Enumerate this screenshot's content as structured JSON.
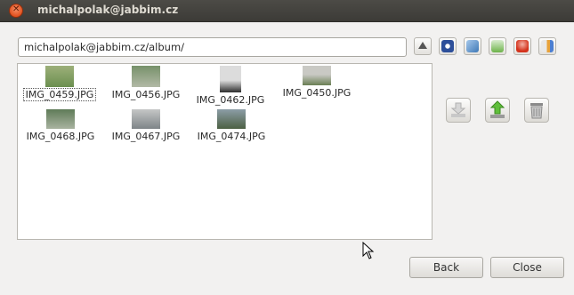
{
  "window": {
    "title": "michalpolak@jabbim.cz"
  },
  "address": {
    "value": "michalpolak@jabbim.cz/album/"
  },
  "toolbar": {
    "icons": [
      "up-arrow-icon",
      "home-icon",
      "refresh-icon",
      "download-icon",
      "delete-user-icon",
      "properties-icon"
    ]
  },
  "files": [
    {
      "name": "IMG_0459.JPG",
      "selected": true,
      "thumb": [
        "#6b8f4f",
        "#9db07a"
      ]
    },
    {
      "name": "IMG_0456.JPG",
      "selected": false,
      "thumb": [
        "#77916a",
        "#b2b9a6"
      ]
    },
    {
      "name": "IMG_0462.JPG",
      "selected": false,
      "thumb": [
        "#dcdcdc",
        "#2c2c2c"
      ]
    },
    {
      "name": "IMG_0450.JPG",
      "selected": false,
      "thumb": [
        "#c9c9c4",
        "#6a7f54"
      ]
    },
    {
      "name": "IMG_0468.JPG",
      "selected": false,
      "thumb": [
        "#5f7b58",
        "#a9b3a0"
      ]
    },
    {
      "name": "IMG_0467.JPG",
      "selected": false,
      "thumb": [
        "#c5c6c6",
        "#7e8488"
      ]
    },
    {
      "name": "IMG_0474.JPG",
      "selected": false,
      "thumb": [
        "#8c9da7",
        "#4c6043"
      ]
    }
  ],
  "actions": {
    "icons": [
      "download-arrow-icon",
      "upload-arrow-icon",
      "trash-icon"
    ]
  },
  "buttons": {
    "back": "Back",
    "close": "Close"
  }
}
